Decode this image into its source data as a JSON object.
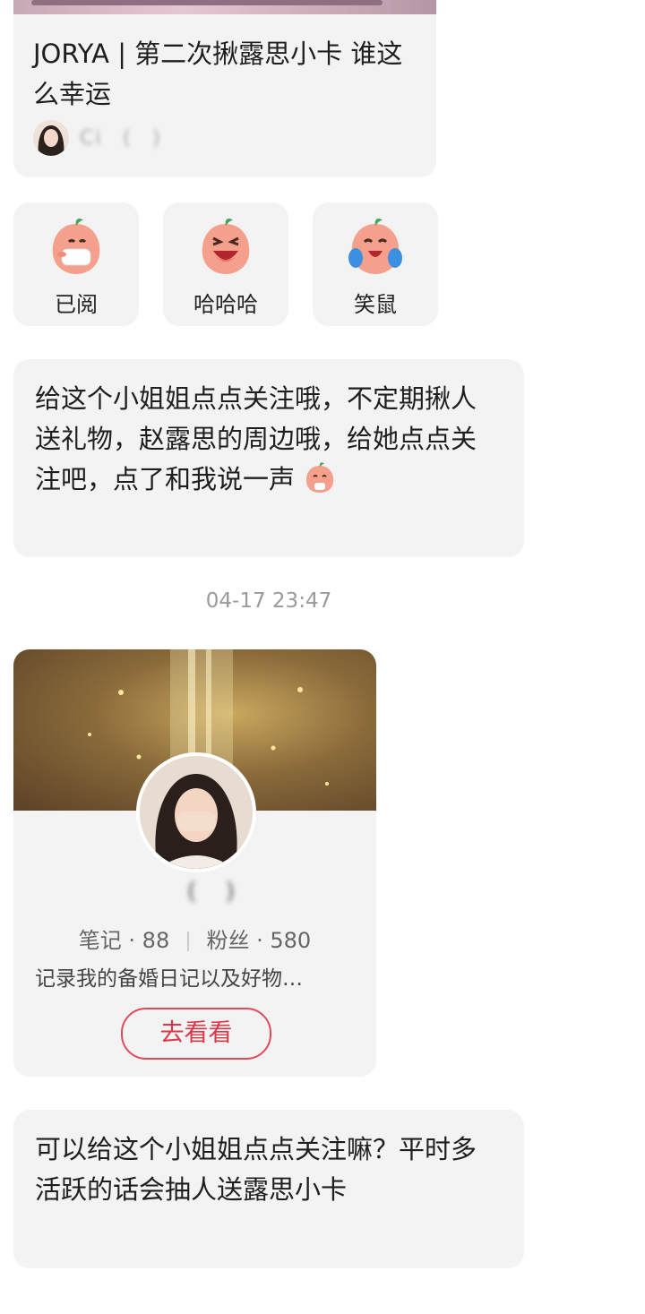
{
  "shared_post": {
    "title": "JORYA | 第二次揪露思小卡 谁这么幸运",
    "author_name": "Ci   (   )"
  },
  "reactions": [
    {
      "label": "已阅",
      "icon": "peach-mask-icon"
    },
    {
      "label": "哈哈哈",
      "icon": "peach-laugh-icon"
    },
    {
      "label": "笑鼠",
      "icon": "peach-cry-laugh-icon"
    }
  ],
  "messages": [
    {
      "text": "给这个小姐姐点点关注哦，不定期揪人送礼物，赵露思的周边哦，给她点点关注吧，点了和我说一声"
    },
    {
      "text": "可以给这个小姐姐点点关注嘛？平时多活跃的话会抽人送露思小卡"
    }
  ],
  "timestamp": "04-17 23:47",
  "profile_card": {
    "name": "    (   )",
    "notes_label": "笔记",
    "notes_count": "88",
    "fans_label": "粉丝",
    "fans_count": "580",
    "bio": "记录我的备婚日记以及好物…",
    "button_label": "去看看"
  },
  "colors": {
    "accent": "#d9384a",
    "card_bg": "#f3f3f3"
  }
}
